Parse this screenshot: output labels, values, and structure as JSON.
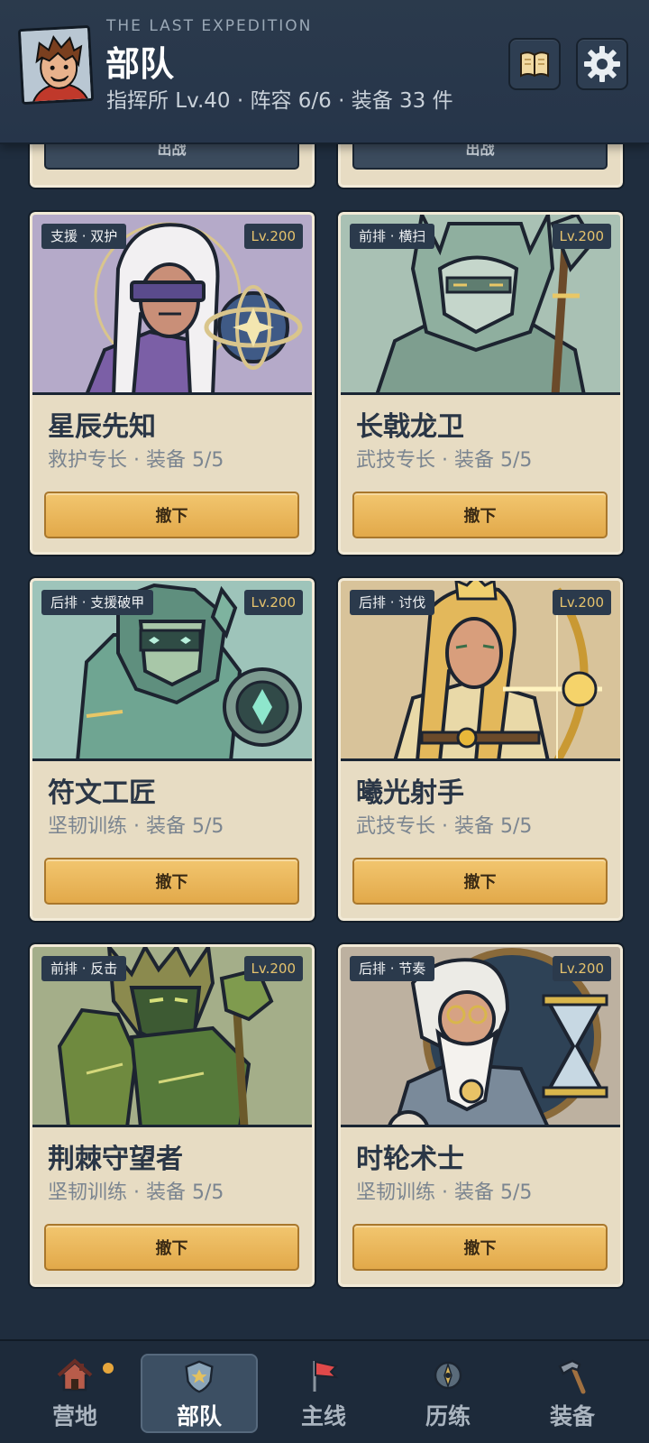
{
  "header": {
    "kicker": "THE LAST EXPEDITION",
    "title": "部队",
    "subline": "指挥所 Lv.40 · 阵容 6/6 · 装备 33 件"
  },
  "header_buttons": [
    {
      "icon": "book-icon"
    },
    {
      "icon": "gear-icon"
    }
  ],
  "peek": [
    {
      "action": "出战"
    },
    {
      "action": "出战"
    }
  ],
  "cards": [
    {
      "tag": "支援 · 双护",
      "level": "Lv.200",
      "name": "星辰先知",
      "meta": "救护专长 · 装备 5/5",
      "action": "撤下",
      "art_color": "#b5aac9"
    },
    {
      "tag": "前排 · 横扫",
      "level": "Lv.200",
      "name": "长戟龙卫",
      "meta": "武技专长 · 装备 5/5",
      "action": "撤下",
      "art_color": "#a9c1b4"
    },
    {
      "tag": "后排 · 支援破甲",
      "level": "Lv.200",
      "name": "符文工匠",
      "meta": "坚韧训练 · 装备 5/5",
      "action": "撤下",
      "art_color": "#9ec4ba"
    },
    {
      "tag": "后排 · 讨伐",
      "level": "Lv.200",
      "name": "曦光射手",
      "meta": "武技专长 · 装备 5/5",
      "action": "撤下",
      "art_color": "#d8c39a"
    },
    {
      "tag": "前排 · 反击",
      "level": "Lv.200",
      "name": "荆棘守望者",
      "meta": "坚韧训练 · 装备 5/5",
      "action": "撤下",
      "art_color": "#a4ae89"
    },
    {
      "tag": "后排 · 节奏",
      "level": "Lv.200",
      "name": "时轮术士",
      "meta": "坚韧训练 · 装备 5/5",
      "action": "撤下",
      "art_color": "#bdb1a0"
    }
  ],
  "nav": [
    {
      "label": "营地",
      "icon": "house-icon",
      "badge": true
    },
    {
      "label": "部队",
      "icon": "shield-icon",
      "active": true
    },
    {
      "label": "主线",
      "icon": "flag-icon"
    },
    {
      "label": "历练",
      "icon": "compass-icon"
    },
    {
      "label": "装备",
      "icon": "hammer-icon"
    }
  ]
}
